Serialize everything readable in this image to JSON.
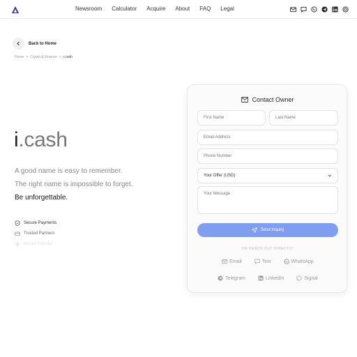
{
  "nav": {
    "items": [
      "Newsroom",
      "Calculator",
      "Acquire",
      "About",
      "FAQ",
      "Legal"
    ],
    "social_icons": [
      "mail-icon",
      "chat-icon",
      "whatsapp-icon",
      "telegram-icon",
      "linkedin-icon",
      "signal-icon"
    ]
  },
  "back": {
    "label": "Back to Home"
  },
  "breadcrumb": {
    "home": "Home",
    "sep": ">",
    "category": "Crypto & Finance",
    "current": "i.cash"
  },
  "domain": {
    "part1": "i",
    "part2": ".cash"
  },
  "tagline": {
    "line1": "A good name is easy to remember.",
    "line2": "The right name is impossible to forget.",
    "line3": "Be unforgettable."
  },
  "features": [
    "Secure Payments",
    "Trusted Partners",
    "Instant Transfer"
  ],
  "contact": {
    "title": "Contact Owner",
    "first_name": "First Name",
    "last_name": "Last Name",
    "email": "Email Address",
    "phone": "Phone Number",
    "offer": "Your Offer (USD)",
    "message": "Your Message",
    "send": "Send Inquiry",
    "or": "OR REACH OUT DIRECTLY",
    "links_row1": [
      "Email",
      "Text",
      "WhatsApp"
    ],
    "links_row2": [
      "Telegram",
      "LinkedIn",
      "Signal"
    ]
  },
  "colors": {
    "accent": "#7f9ef0",
    "logo": "#2a2a9e"
  }
}
